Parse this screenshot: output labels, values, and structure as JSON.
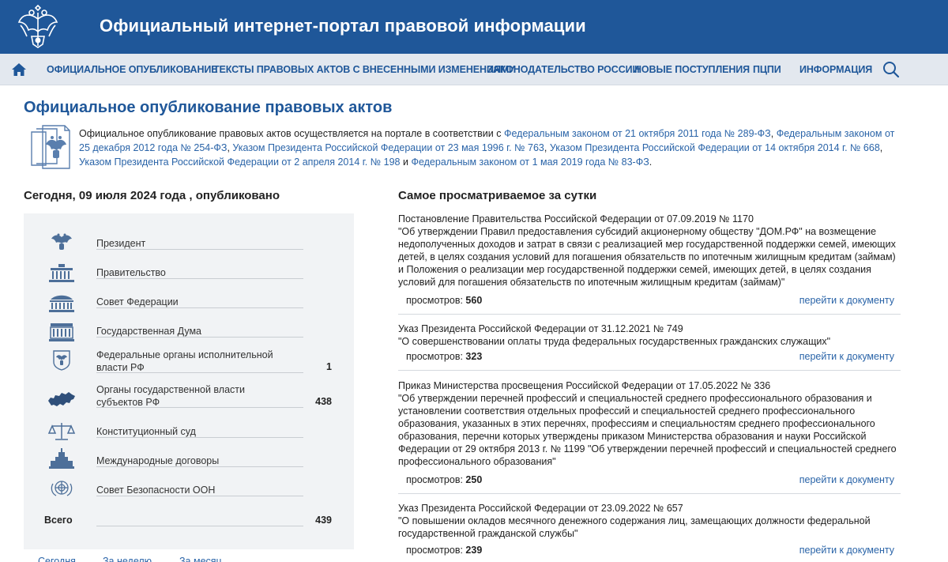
{
  "header": {
    "portal_title": "Официальный интернет-портал правовой информации"
  },
  "nav": {
    "items": [
      "ОФИЦИАЛЬНОЕ ОПУБЛИКОВАНИЕ",
      "ТЕКСТЫ ПРАВОВЫХ АКТОВ С ВНЕСЕННЫМИ ИЗМЕНЕНИЯМИ",
      "ЗАКОНОДАТЕЛЬСТВО РОССИИ",
      "НОВЫЕ ПОСТУПЛЕНИЯ",
      "ПЦПИ",
      "ИНФОРМАЦИЯ"
    ]
  },
  "page": {
    "title": "Официальное опубликование правовых актов",
    "intro_text": "Официальное опубликование правовых актов осуществляется на портале в соответствии с",
    "intro_links": [
      "Федеральным  законом от 21 октября 2011 года № 289-ФЗ",
      "Федеральным законом от 25 декабря 2012 года № 254-ФЗ",
      "Указом Президента Российской Федерации от 23 мая 1996 г. № 763",
      "Указом Президента Российской Федерации от 14 октября 2014 г. № 668",
      "Указом Президента Российской Федерации от 2 апреля 2014 г. № 198",
      "Федеральным законом от 1 мая 2019 года № 83-ФЗ"
    ],
    "intro_and": "и"
  },
  "today": {
    "title": "Сегодня, 09 июля 2024 года , опубликовано",
    "rows": [
      {
        "label": "Президент",
        "count": "",
        "icon": "eagle-icon"
      },
      {
        "label": "Правительство",
        "count": "",
        "icon": "government-building-icon"
      },
      {
        "label": "Совет Федерации",
        "count": "",
        "icon": "federation-council-icon"
      },
      {
        "label": "Государственная Дума",
        "count": "",
        "icon": "duma-building-icon"
      },
      {
        "label": "Федеральные органы исполнительной власти РФ",
        "count": "1",
        "icon": "shield-eagle-icon"
      },
      {
        "label": "Органы государственной власти субъектов РФ",
        "count": "438",
        "icon": "russia-map-icon"
      },
      {
        "label": "Конституционный суд",
        "count": "",
        "icon": "scales-icon"
      },
      {
        "label": "Международные договоры",
        "count": "",
        "icon": "tower-icon"
      },
      {
        "label": "Совет Безопасности ООН",
        "count": "",
        "icon": "un-icon"
      }
    ],
    "total_label": "Всего",
    "total_count": "439",
    "tabs": [
      "Сегодня",
      "За неделю",
      "За месяц"
    ]
  },
  "popular": {
    "title": "Самое просматриваемое за сутки",
    "views_label": "просмотров:",
    "link_label": "перейти к документу",
    "docs": [
      {
        "head": "Постановление Правительства Российской Федерации от 07.09.2019 № 1170",
        "body": "\"Об утверждении Правил предоставления субсидий акционерному обществу \"ДОМ.РФ\" на возмещение недополученных доходов и затрат в связи с реализацией мер государственной поддержки семей, имеющих детей, в целях создания условий для погашения обязательств по ипотечным жилищным кредитам (займам) и Положения о реализации мер государственной поддержки семей, имеющих детей, в целях создания условий для погашения обязательств по ипотечным жилищным кредитам (займам)\"",
        "views": "560"
      },
      {
        "head": "Указ Президента Российской Федерации от 31.12.2021 № 749",
        "body": "\"О совершенствовании оплаты труда федеральных государственных гражданских служащих\"",
        "views": "323"
      },
      {
        "head": "Приказ Министерства просвещения Российской Федерации от 17.05.2022 № 336",
        "body": "\"Об утверждении перечней профессий и специальностей среднего профессионального образования и установлении соответствия отдельных профессий и специальностей среднего профессионального образования, указанных в этих перечнях, профессиям и специальностям среднего профессионального образования, перечни которых утверждены приказом Министерства образования и науки Российской Федерации от 29 октября 2013 г. № 1199 \"Об утверждении перечней профессий и специальностей среднего профессионального образования\"",
        "views": "250"
      },
      {
        "head": "Указ Президента Российской Федерации от 23.09.2022 № 657",
        "body": "\"О повышении окладов месячного денежного содержания лиц, замещающих должности федеральной государственной гражданской службы\"",
        "views": "239"
      }
    ]
  },
  "colors": {
    "brand_blue": "#1f5799",
    "link_blue": "#2a64a8",
    "nav_bg": "#e3e8ef",
    "panel_bg": "#f1f3f5"
  }
}
